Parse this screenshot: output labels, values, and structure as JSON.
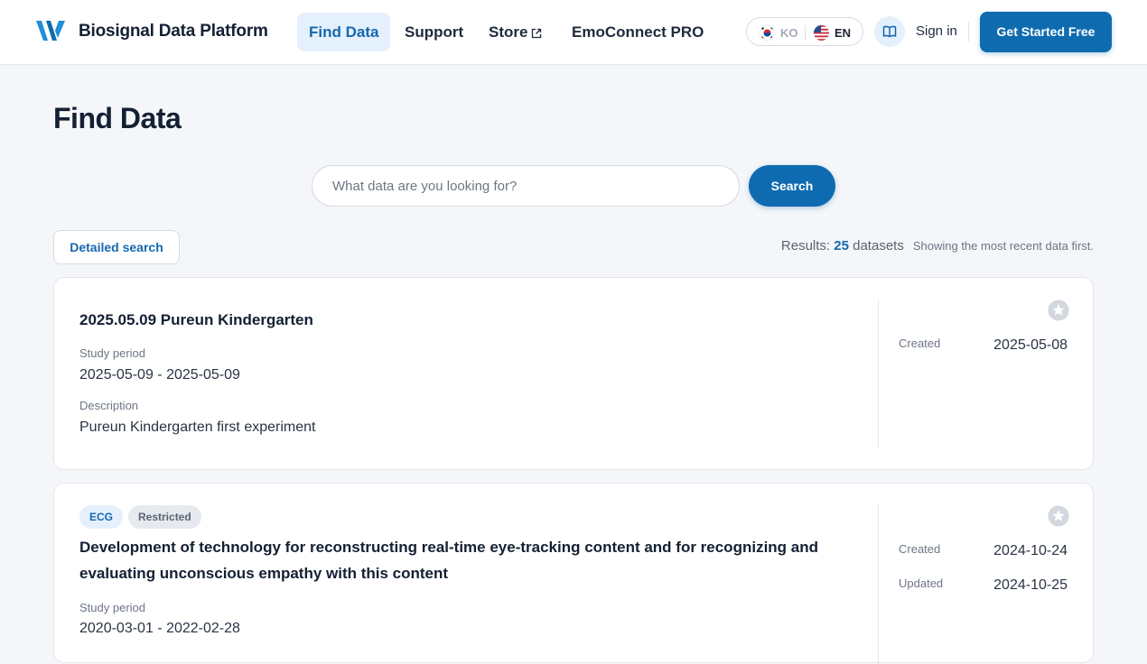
{
  "header": {
    "brand": "Biosignal Data Platform",
    "nav": {
      "find_data": "Find Data",
      "support": "Support",
      "store": "Store",
      "emoconnect": "EmoConnect PRO"
    },
    "lang": {
      "ko": "KO",
      "en": "EN"
    },
    "sign_in": "Sign in",
    "get_started": "Get Started Free",
    "icons": {
      "logo": "w-logo-icon",
      "external": "external-link-icon",
      "book": "book-icon",
      "flag_ko": "korea-flag-icon",
      "flag_en": "us-flag-icon"
    }
  },
  "main": {
    "title": "Find Data",
    "search": {
      "placeholder": "What data are you looking for?",
      "button": "Search"
    },
    "detailed_search": "Detailed search",
    "results": {
      "label": "Results:",
      "count": "25",
      "unit": "datasets",
      "note": "Showing the most recent data first."
    }
  },
  "datasets": [
    {
      "tags": [],
      "title": "2025.05.09 Pureun Kindergarten",
      "study_period_label": "Study period",
      "study_period": "2025-05-09 - 2025-05-09",
      "description_label": "Description",
      "description": "Pureun Kindergarten first experiment",
      "created_label": "Created",
      "created": "2025-05-08"
    },
    {
      "tags": [
        "ECG",
        "Restricted"
      ],
      "title": "Development of technology for reconstructing real-time eye-tracking content and for recognizing and evaluating unconscious empathy with this content",
      "study_period_label": "Study period",
      "study_period": "2020-03-01 - 2022-02-28",
      "created_label": "Created",
      "created": "2024-10-24",
      "updated_label": "Updated",
      "updated": "2024-10-25"
    }
  ],
  "colors": {
    "accent": "#0f6bb0",
    "accent_light": "#e4f0fb",
    "background": "#f4f6f9"
  }
}
